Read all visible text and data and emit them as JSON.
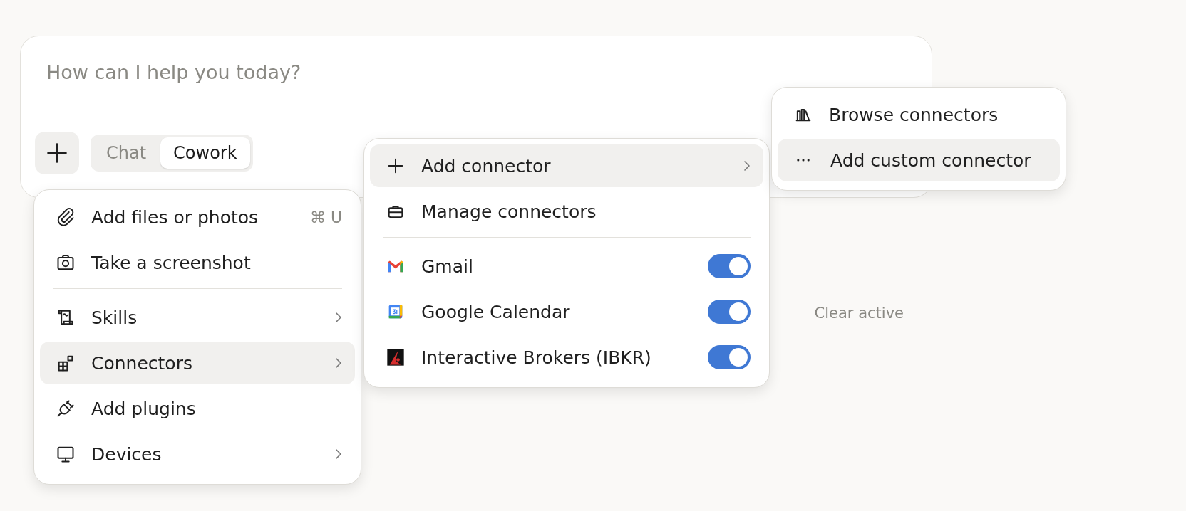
{
  "composer": {
    "placeholder": "How can I help you today?",
    "modes": [
      {
        "label": "Chat",
        "selected": false
      },
      {
        "label": "Cowork",
        "selected": true
      }
    ]
  },
  "background": {
    "clear_link": "Clear active"
  },
  "attach_menu": {
    "sections": [
      {
        "items": [
          {
            "label": "Add files or photos",
            "shortcut": "⌘ U",
            "submenu": false,
            "selected": false
          },
          {
            "label": "Take a screenshot",
            "submenu": false,
            "selected": false
          }
        ]
      },
      {
        "items": [
          {
            "label": "Skills",
            "submenu": true,
            "selected": false
          },
          {
            "label": "Connectors",
            "submenu": true,
            "selected": true
          },
          {
            "label": "Add plugins",
            "submenu": false,
            "selected": false
          },
          {
            "label": "Devices",
            "submenu": true,
            "selected": false
          }
        ]
      }
    ]
  },
  "connectors_menu": {
    "sections": [
      {
        "items": [
          {
            "label": "Add connector",
            "submenu": true,
            "selected": true
          },
          {
            "label": "Manage connectors",
            "submenu": false,
            "selected": false
          }
        ]
      },
      {
        "items": [
          {
            "label": "Gmail",
            "on": true,
            "selected": false
          },
          {
            "label": "Google Calendar",
            "on": true,
            "selected": false
          },
          {
            "label": "Interactive Brokers (IBKR)",
            "on": true,
            "selected": false
          }
        ]
      }
    ]
  },
  "add_connector_menu": {
    "sections": [
      {
        "items": [
          {
            "label": "Browse connectors",
            "submenu": false,
            "selected": false
          },
          {
            "label": "Add custom connector",
            "submenu": false,
            "selected": true
          }
        ]
      }
    ]
  }
}
